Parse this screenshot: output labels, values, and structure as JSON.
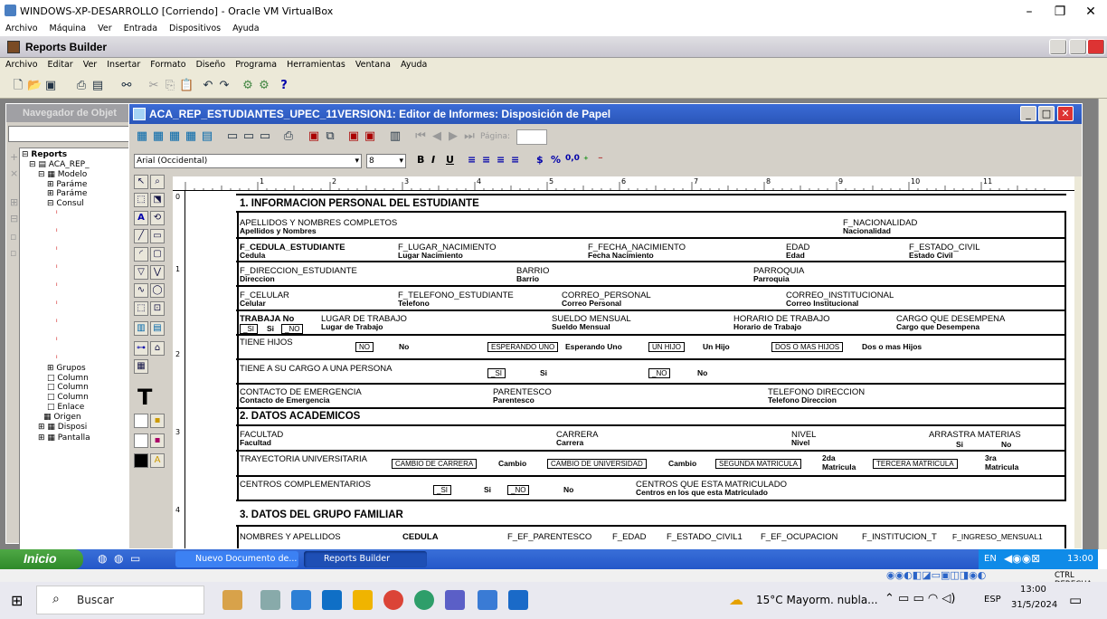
{
  "vb": {
    "title": "WINDOWS-XP-DESARROLLO [Corriendo] - Oracle VM VirtualBox",
    "menu": [
      "Archivo",
      "Máquina",
      "Ver",
      "Entrada",
      "Dispositivos",
      "Ayuda"
    ],
    "status_right": "CTRL DERECHA"
  },
  "app": {
    "title": "Reports Builder",
    "menu": [
      "Archivo",
      "Editar",
      "Ver",
      "Insertar",
      "Formato",
      "Diseño",
      "Programa",
      "Herramientas",
      "Ventana",
      "Ayuda"
    ]
  },
  "navigator": {
    "title": "Navegador de Objet",
    "tree": [
      "Reports",
      "ACA_REP_",
      "Modelo",
      "Paráme",
      "Paráme",
      "Consul",
      "Grupos",
      "Column",
      "Column",
      "Column",
      "Enlace",
      "Origen",
      "Disposi",
      "Pantalla"
    ]
  },
  "editor": {
    "title": "ACA_REP_ESTUDIANTES_UPEC_11VERSION1: Editor de Informes: Disposición de Papel",
    "page_label": "Página:",
    "font_name": "Arial (Occidental)",
    "font_size": "8",
    "fmt": [
      "B",
      "I",
      "U",
      "$",
      "%",
      "0,0"
    ],
    "ruler_nums": [
      "1",
      "2",
      "3",
      "4",
      "5",
      "6",
      "7",
      "8",
      "9",
      "10",
      "11"
    ],
    "vruler_nums": [
      "0",
      "1",
      "2",
      "3",
      "4"
    ]
  },
  "report": {
    "s1": "1. INFORMACION PERSONAL DEL ESTUDIANTE",
    "r1a": "APELLIDOS Y NOMBRES COMPLETOS",
    "r1a_f": "Apellidos y Nombres",
    "r1b": "F_NACIONALIDAD",
    "r1b_f": "Nacionalidad",
    "r2a": "F_CEDULA_ESTUDIANTE",
    "r2a_f": "Cedula",
    "r2b": "F_LUGAR_NACIMIENTO",
    "r2b_f": "Lugar Nacimiento",
    "r2c": "F_FECHA_NACIMIENTO",
    "r2c_f": "Fecha Nacimiento",
    "r2d": "EDAD",
    "r2d_f": "Edad",
    "r2e": "F_ESTADO_CIVIL",
    "r2e_f": "Estado Civil",
    "r3a": "F_DIRECCION_ESTUDIANTE",
    "r3a_f": "Direccion",
    "r3b": "BARRIO",
    "r3b_f": "Barrio",
    "r3c": "PARROQUIA",
    "r3c_f": "Parroquia",
    "r4a": "F_CELULAR",
    "r4a_f": "Celular",
    "r4b": "F_TELEFONO_ESTUDIANTE",
    "r4b_f": "Telefono",
    "r4c": "CORREO_PERSONAL",
    "r4c_f": "Correo Personal",
    "r4d": "CORREO_INSTITUCIONAL",
    "r4d_f": "Correo Institucional",
    "r5a": "TRABAJA  No",
    "r5a_si": "_SI",
    "r5a_si_l": "Si",
    "r5a_no": "_NO",
    "r5b": "LUGAR DE TRABAJO",
    "r5b_f": "Lugar de Trabajo",
    "r5c": "SUELDO MENSUAL",
    "r5c_f": "Sueldo Mensual",
    "r5d": "HORARIO DE TRABAJO",
    "r5d_f": "Horario de Trabajo",
    "r5e": "CARGO QUE DESEMPENA",
    "r5e_f": "Cargo que Desempena",
    "r6a": "TIENE HIJOS",
    "r6_no": "NO",
    "r6_no_l": "No",
    "r6_esp": "ESPERANDO UNO",
    "r6_esp_l": "Esperando Uno",
    "r6_un": "UN HIJO",
    "r6_un_l": "Un Hijo",
    "r6_dos": "DOS O MAS HIJOS",
    "r6_dos_l": "Dos o mas Hijos",
    "r7a": "TIENE A SU CARGO A UNA PERSONA",
    "r7_si": "_SI",
    "r7_si_l": "Si",
    "r7_no": "_NO",
    "r7_no_l": "No",
    "r8a": "CONTACTO DE EMERGENCIA",
    "r8a_f": "Contacto de Emergencia",
    "r8b": "PARENTESCO",
    "r8b_f": "Parentesco",
    "r8c": "TELEFONO DIRECCION",
    "r8c_f": "Telefono Direccion",
    "s2": "2. DATOS ACADEMICOS",
    "r9a": "FACULTAD",
    "r9a_f": "Facultad",
    "r9b": "CARRERA",
    "r9b_f": "Carrera",
    "r9c": "NIVEL",
    "r9c_f": "Nivel",
    "r9d": "ARRASTRA MATERIAS",
    "r9d_si": "Si",
    "r9d_no": "No",
    "r10a": "TRAYECTORIA UNIVERSITARIA",
    "r10_cc": "CAMBIO DE CARRERA",
    "r10_cc_l": "Cambio",
    "r10_cu": "CAMBIO DE UNIVERSIDAD",
    "r10_cu_l": "Cambio",
    "r10_sm": "SEGUNDA MATRICULA",
    "r10_sm_l": "2da Matricula",
    "r10_tm": "TERCERA MATRICULA",
    "r10_tm_l": "3ra Matricula",
    "r11a": "CENTROS COMPLEMENTARIOS",
    "r11_si": "_SI",
    "r11_si_l": "Si",
    "r11_no": "_NO",
    "r11_no_l": "No",
    "r11b": "CENTROS QUE ESTA MATRICULADO",
    "r11b_f": "Centros en los que esta Matriculado",
    "s3": "3. DATOS DEL GRUPO FAMILIAR",
    "r12": [
      "NOMBRES Y APELLIDOS",
      "CEDULA",
      "F_EF_PARENTESCO",
      "F_EDAD",
      "F_ESTADO_CIVIL1",
      "F_EF_OCUPACION",
      "F_INSTITUCION_T",
      "F_INGRESO_MENSUAL1"
    ]
  },
  "xp_taskbar": {
    "start": "Inicio",
    "task1": "Nuevo Documento de...",
    "task2": "Reports Builder",
    "lang": "EN",
    "time": "13:00"
  },
  "win10": {
    "search": "Buscar",
    "weather": "15°C  Mayorm. nubla...",
    "lang": "ESP",
    "time": "13:00",
    "date": "31/5/2024"
  }
}
